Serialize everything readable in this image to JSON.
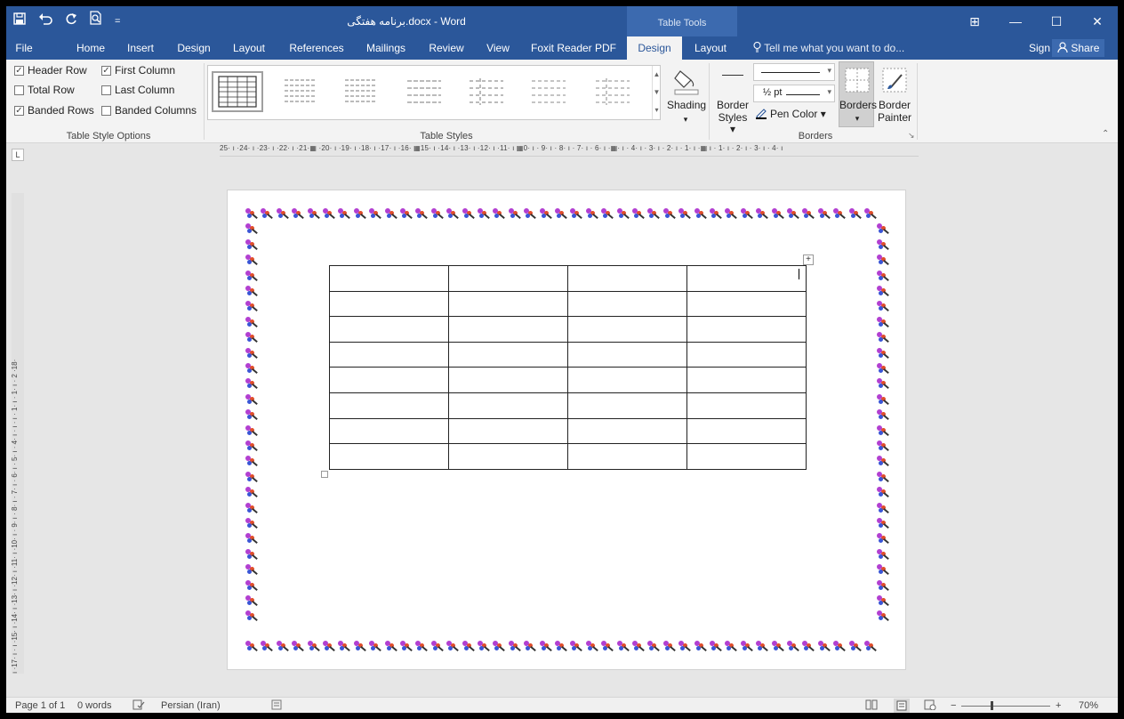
{
  "titlebar": {
    "doc_title": "برنامه هفتگی.docx - Word",
    "context_group": "Table Tools",
    "qat_save_icon": "save-icon",
    "qat_undo_icon": "undo-icon",
    "qat_redo_icon": "redo-icon",
    "qat_preview_icon": "print-preview-icon",
    "qat_customize": "="
  },
  "window": {
    "ribbon_display": "⊞",
    "minimize": "—",
    "maximize": "☐",
    "close": "✕"
  },
  "tabs": [
    "File",
    "Home",
    "Insert",
    "Design",
    "Layout",
    "References",
    "Mailings",
    "Review",
    "View",
    "Foxit Reader PDF",
    "Design",
    "Layout"
  ],
  "active_tab_index": 10,
  "tell_me": "Tell me what you want to do...",
  "account": {
    "sign_in": "Sign in",
    "share": "Share"
  },
  "table_style_options": {
    "label": "Table Style Options",
    "header_row": "Header Row",
    "first_column": "First Column",
    "total_row": "Total Row",
    "last_column": "Last Column",
    "banded_rows": "Banded Rows",
    "banded_columns": "Banded Columns",
    "checked_mark": "✓"
  },
  "table_styles": {
    "label": "Table Styles"
  },
  "shading": {
    "label": "Shading"
  },
  "borders_group": {
    "label": "Borders",
    "border_styles_line1": "Border",
    "border_styles_line2": "Styles ▾",
    "weight": "½ pt",
    "pen_color": "Pen Color ▾",
    "borders": "Borders",
    "border_painter_line1": "Border",
    "border_painter_line2": "Painter",
    "dropdown_caret": "▾"
  },
  "ruler": {
    "corner": "L",
    "horizontal": "25· ı ·24· ı ·23· ı ·22· ı ·21·▦ ·20· ı ·19· ı ·18· ı ·17· ı ·16· ▦15· ı ·14· ı ·13· ı ·12· ı ·11· ı ▦0· ı · 9· ı · 8· ı · 7· ı · 6· ı ·▦· ı · 4· ı · 3· ı · 2· ı · 1· ı ·▦ ı · 1· ı · 2· ı · 3· ı · 4· ı",
    "vertical": "·18· ı ·17· ı · ı ·15· ı ·14· ı ·13· ı ·12· ı ·11· ı ·10· ı · 9· ı · 8· ı · 7· ı · 6· ı · 5· ı · 4· ı · ı · ı · 1· ı · 1· ı · 2"
  },
  "document": {
    "table_rows": 8,
    "table_cols": 4,
    "move_handle": "+"
  },
  "statusbar": {
    "page": "Page 1 of 1",
    "words": "0 words",
    "language": "Persian (Iran)",
    "zoom": "70%",
    "zoom_minus": "−",
    "zoom_plus": "+",
    "zoom_level": 0.7
  }
}
